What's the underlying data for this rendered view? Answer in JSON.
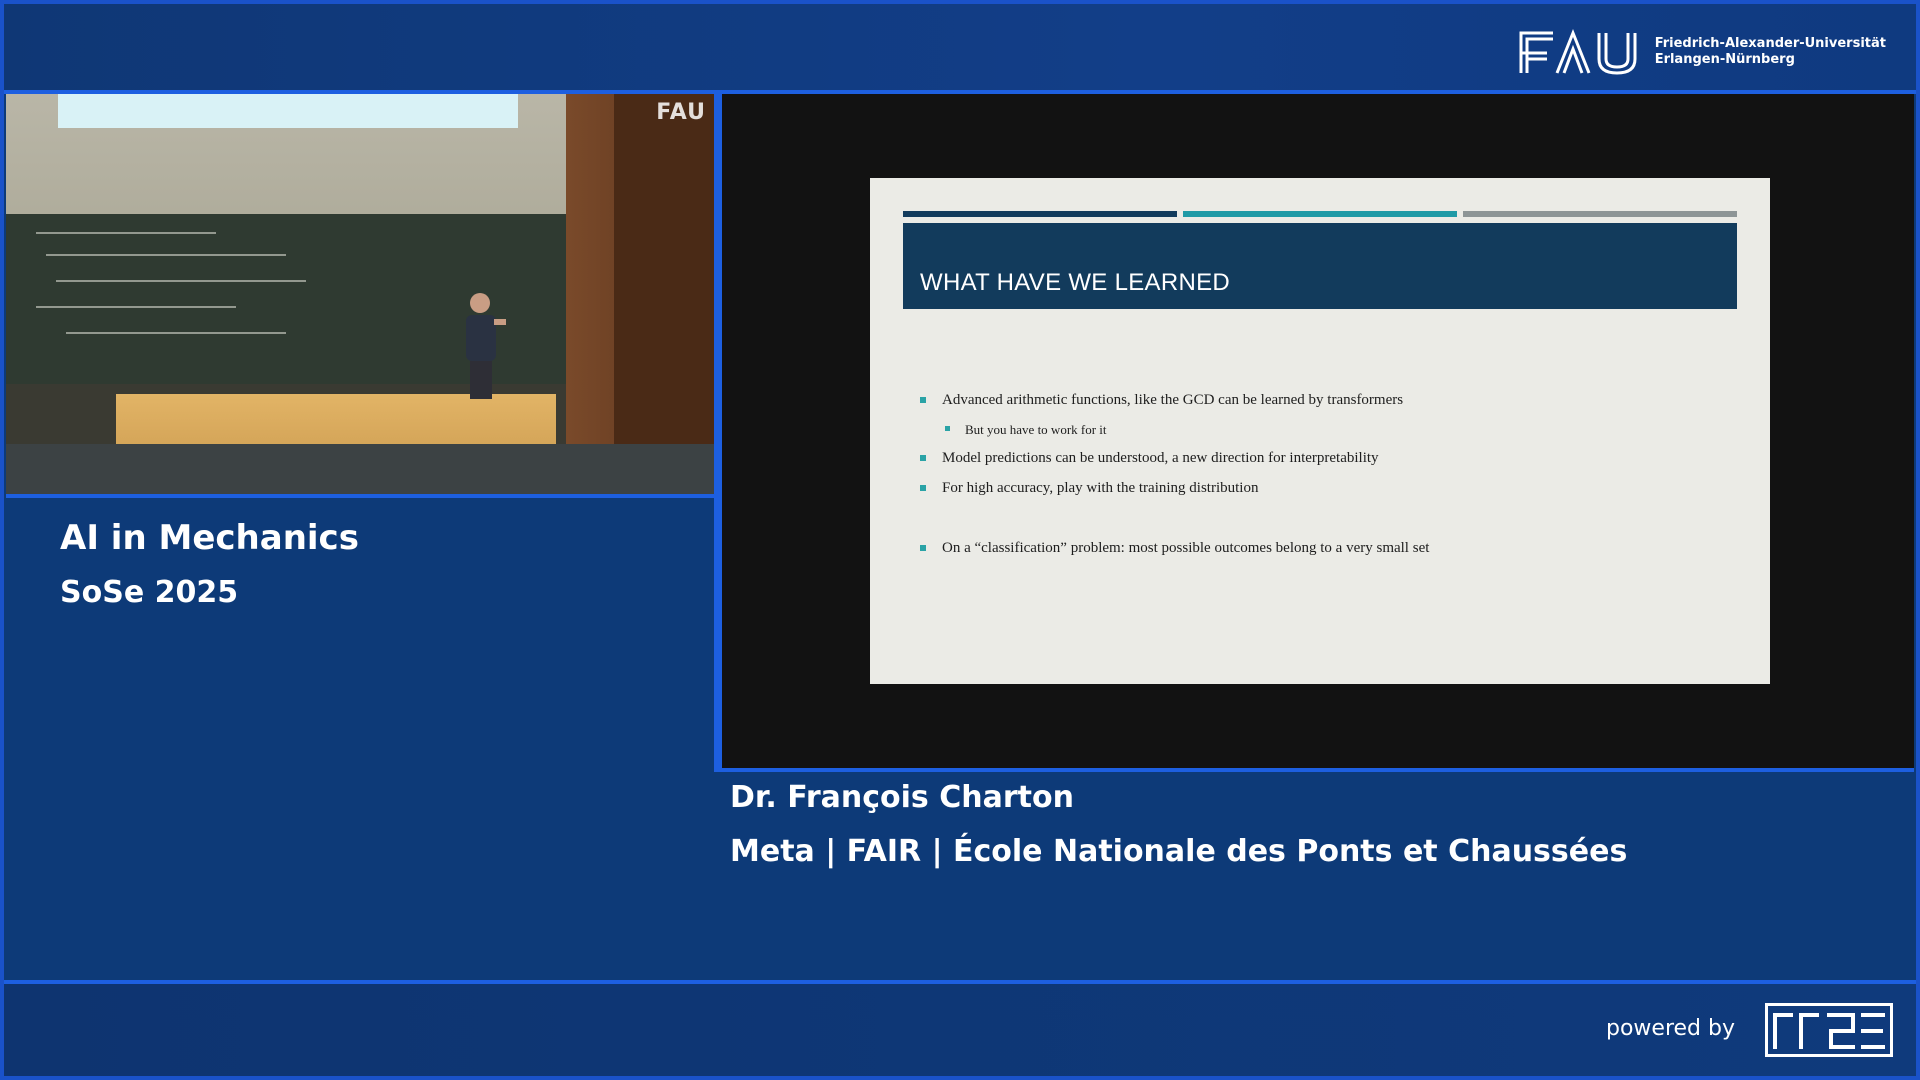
{
  "header": {
    "logo_letters": "FAU",
    "university_line1": "Friedrich-Alexander-Universität",
    "university_line2": "Erlangen-Nürnberg"
  },
  "camera": {
    "watermark": "FAU"
  },
  "course": {
    "title": "AI in Mechanics",
    "term": "SoSe 2025"
  },
  "slide": {
    "title": "WHAT HAVE WE LEARNED",
    "bar_colors": [
      "#123b5c",
      "#1f9aa6",
      "#8d9596"
    ],
    "bullets": [
      {
        "text": "Advanced arithmetic functions, like the GCD can be learned by transformers",
        "level": 1
      },
      {
        "text": "But you have to work for it",
        "level": 2
      },
      {
        "text": "Model predictions can be understood, a new direction for interpretability",
        "level": 1
      },
      {
        "text": "For high accuracy, play with the training distribution",
        "level": 1
      },
      {
        "text": "On a “classification” problem: most possible outcomes belong to a very small set",
        "level": 1
      }
    ]
  },
  "speaker": {
    "name": "Dr. François Charton",
    "affiliation": "Meta | FAIR | École Nationale des Ponts et Chaussées"
  },
  "footer": {
    "powered_by": "powered by",
    "logo_icon": "rrze-logo-icon"
  },
  "colors": {
    "background": "#0d3a78",
    "accent_border": "#1a52c9",
    "slide_title_bg": "#123b5c",
    "bullet_teal": "#2aa3a6"
  }
}
